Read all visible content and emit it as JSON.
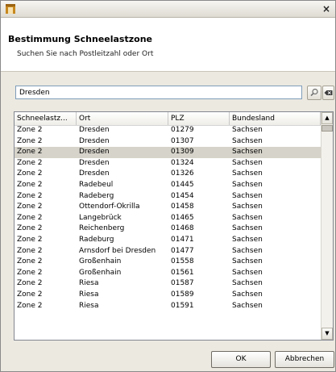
{
  "window": {
    "close_glyph": "×"
  },
  "header": {
    "title": "Bestimmung Schneelastzone",
    "subtitle": "Suchen Sie nach Postleitzahl oder Ort"
  },
  "search": {
    "value": "Dresden",
    "search_icon": "search-icon",
    "clear_icon": "clear-icon"
  },
  "table": {
    "columns": [
      "Schneelastz...",
      "Ort",
      "PLZ",
      "Bundesland"
    ],
    "selected_index": 2,
    "rows": [
      [
        "Zone 2",
        "Dresden",
        "01279",
        "Sachsen"
      ],
      [
        "Zone 2",
        "Dresden",
        "01307",
        "Sachsen"
      ],
      [
        "Zone 2",
        "Dresden",
        "01309",
        "Sachsen"
      ],
      [
        "Zone 2",
        "Dresden",
        "01324",
        "Sachsen"
      ],
      [
        "Zone 2",
        "Dresden",
        "01326",
        "Sachsen"
      ],
      [
        "Zone 2",
        "Radebeul",
        "01445",
        "Sachsen"
      ],
      [
        "Zone 2",
        "Radeberg",
        "01454",
        "Sachsen"
      ],
      [
        "Zone 2",
        "Ottendorf-Okrilla",
        "01458",
        "Sachsen"
      ],
      [
        "Zone 2",
        "Langebrück",
        "01465",
        "Sachsen"
      ],
      [
        "Zone 2",
        "Reichenberg",
        "01468",
        "Sachsen"
      ],
      [
        "Zone 2",
        "Radeburg",
        "01471",
        "Sachsen"
      ],
      [
        "Zone 2",
        "Arnsdorf bei Dresden",
        "01477",
        "Sachsen"
      ],
      [
        "Zone 2",
        "Großenhain",
        "01558",
        "Sachsen"
      ],
      [
        "Zone 2",
        "Großenhain",
        "01561",
        "Sachsen"
      ],
      [
        "Zone 2",
        "Riesa",
        "01587",
        "Sachsen"
      ],
      [
        "Zone 2",
        "Riesa",
        "01589",
        "Sachsen"
      ],
      [
        "Zone 2",
        "Riesa",
        "01591",
        "Sachsen"
      ]
    ]
  },
  "footer": {
    "ok_label": "OK",
    "cancel_label": "Abbrechen"
  },
  "colors": {
    "selection": "#d6d3ca",
    "app_icon": "#c7881e"
  }
}
